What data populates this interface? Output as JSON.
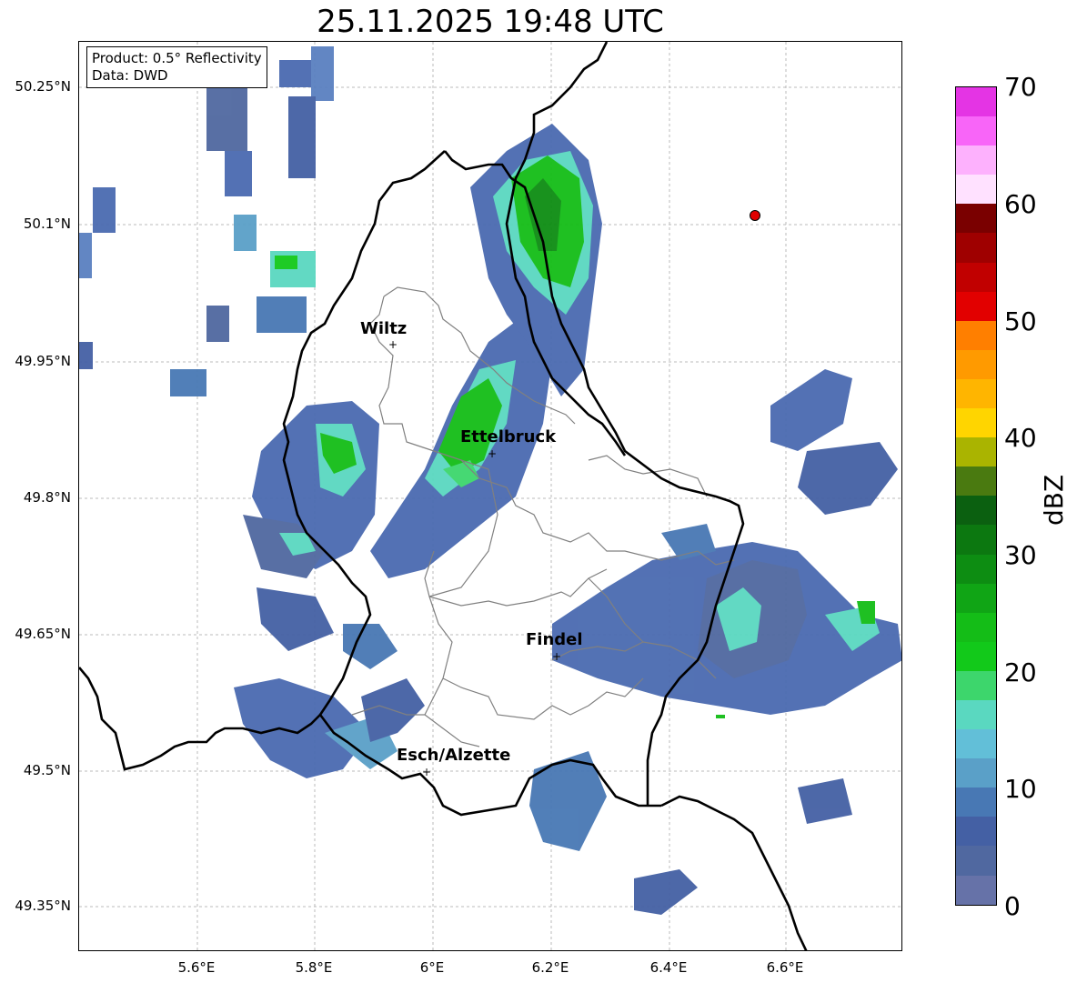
{
  "title": "25.11.2025 19:48 UTC",
  "info": {
    "product": "Product: 0.5° Reflectivity",
    "data": "Data: DWD"
  },
  "axes": {
    "lat_ticks": [
      "50.25°N",
      "50.1°N",
      "49.95°N",
      "49.8°N",
      "49.65°N",
      "49.5°N",
      "49.35°N"
    ],
    "lon_ticks": [
      "5.6°E",
      "5.8°E",
      "6°E",
      "6.2°E",
      "6.4°E",
      "6.6°E"
    ]
  },
  "cities": [
    {
      "name": "Wiltz"
    },
    {
      "name": "Ettelbruck"
    },
    {
      "name": "Findel"
    },
    {
      "name": "Esch/Alzette"
    }
  ],
  "colorbar": {
    "label": "dBZ",
    "ticks": [
      "70",
      "60",
      "50",
      "40",
      "30",
      "20",
      "10",
      "0"
    ],
    "colors_top_to_bottom": [
      "#e434e4",
      "#f865f8",
      "#fdb1fd",
      "#ffe1ff",
      "#7a0000",
      "#9f0000",
      "#c10000",
      "#e20000",
      "#ff7f00",
      "#ff9a00",
      "#ffb500",
      "#ffd500",
      "#aab400",
      "#4a7a10",
      "#0b6010",
      "#0c7810",
      "#0d8d12",
      "#10a515",
      "#14bd17",
      "#12c91a",
      "#3dd66c",
      "#5ad8c0",
      "#62bfd8",
      "#5aa0c8",
      "#4878b4",
      "#4460a4",
      "#5068a0",
      "#6672a8"
    ]
  },
  "marker_color": "#e00000"
}
